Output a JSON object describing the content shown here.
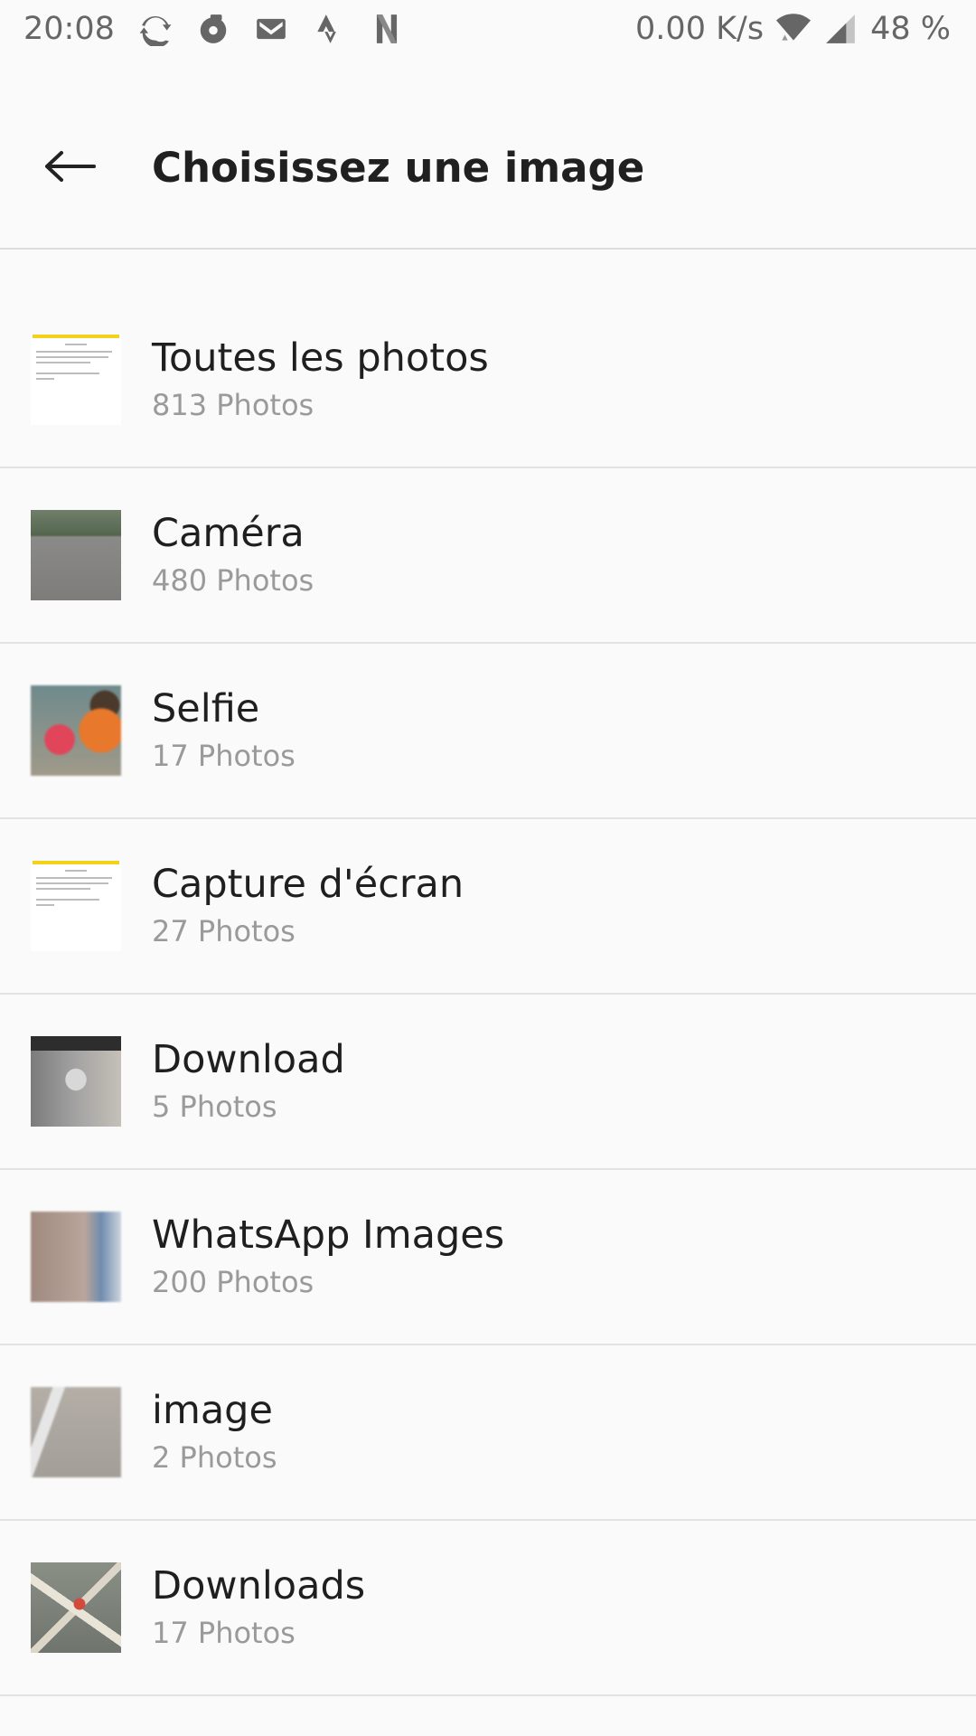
{
  "status_bar": {
    "time": "20:08",
    "network_speed": "0.00 K/s",
    "battery": "48 %",
    "icons": [
      "sync-icon",
      "record-icon",
      "gmail-icon",
      "strava-icon",
      "netflix-icon",
      "wifi-icon",
      "signal-icon"
    ]
  },
  "app_bar": {
    "title": "Choisissez une image",
    "back_icon": "arrow-left-icon"
  },
  "albums": [
    {
      "name": "Toutes les photos",
      "count": "813 Photos"
    },
    {
      "name": "Caméra",
      "count": "480 Photos"
    },
    {
      "name": "Selfie",
      "count": "17 Photos"
    },
    {
      "name": "Capture d'écran",
      "count": "27 Photos"
    },
    {
      "name": "Download",
      "count": "5 Photos"
    },
    {
      "name": "WhatsApp Images",
      "count": "200 Photos"
    },
    {
      "name": "image",
      "count": "2 Photos"
    },
    {
      "name": "Downloads",
      "count": "17 Photos"
    }
  ],
  "colors": {
    "background": "#fafafa",
    "text_primary": "#1f1f1f",
    "text_secondary": "#9a9a9a",
    "divider": "#e2e2e2",
    "doc_accent": "#f2d21b"
  }
}
